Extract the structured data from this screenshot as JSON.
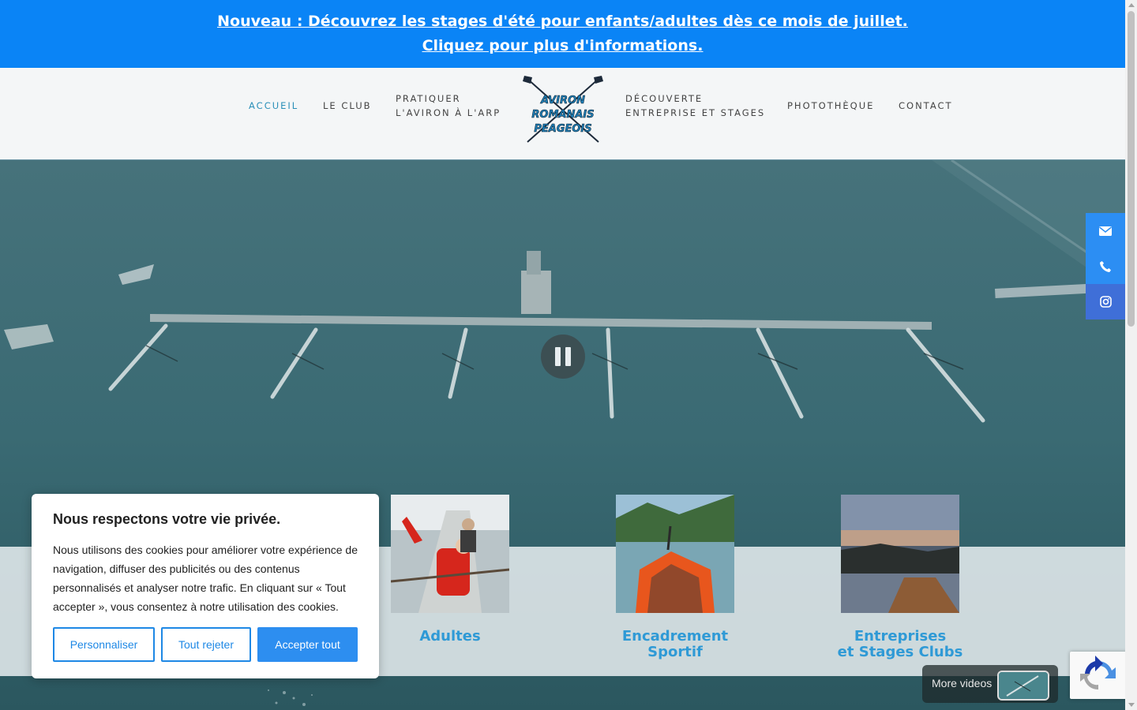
{
  "announcement": {
    "line1": "Nouveau : Découvrez les stages d'été pour enfants/adultes dès ce mois de juillet.",
    "line2": "Cliquez pour plus d'informations."
  },
  "nav": {
    "accueil": "ACCUEIL",
    "le_club": "LE CLUB",
    "pratiquer_1": "PRATIQUER",
    "pratiquer_2": "L'AVIRON À L'ARP",
    "decouverte_1": "DÉCOUVERTE",
    "decouverte_2": "ENTREPRISE ET STAGES",
    "phototheque": "PHOTOTHÈQUE",
    "contact": "CONTACT",
    "active_color": "#2a8fb8"
  },
  "logo": {
    "line1": "AVIRON",
    "line2": "ROMANAIS",
    "line3": "PEAGEOIS"
  },
  "side_buttons": [
    {
      "icon": "envelope-icon",
      "color": "#2c8ef3"
    },
    {
      "icon": "phone-icon",
      "color": "#2c8ef3"
    },
    {
      "icon": "instagram-icon",
      "color": "#3f6fd8"
    }
  ],
  "cards": [
    {
      "title": "Adultes"
    },
    {
      "title_line1": "Encadrement",
      "title_line2": "Sportif"
    },
    {
      "title_line1": "Entreprises",
      "title_line2": "et Stages Clubs"
    }
  ],
  "cookie": {
    "title": "Nous respectons votre vie privée.",
    "body": "Nous utilisons des cookies pour améliorer votre expérience de navigation, diffuser des publicités ou des contenus personnalisés et analyser notre trafic. En cliquant sur « Tout accepter », vous consentez à notre utilisation des cookies.",
    "btn_customize": "Personnaliser",
    "btn_reject": "Tout rejeter",
    "btn_accept": "Accepter tout"
  },
  "more_videos": {
    "label": "More videos"
  },
  "colors": {
    "banner": "#0a84f6",
    "card_title": "#2f9ad6",
    "accept": "#2d8ef0"
  }
}
